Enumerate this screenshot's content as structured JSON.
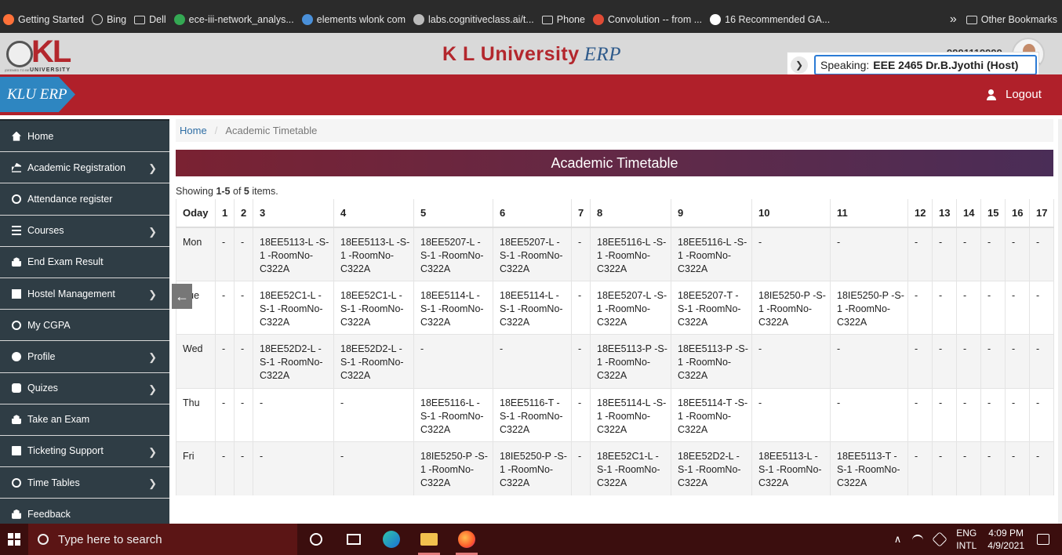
{
  "bookmarks": [
    {
      "label": "Getting Started",
      "icon": "firefox-icon",
      "color": "#ff7139"
    },
    {
      "label": "Bing",
      "icon": "globe-icon"
    },
    {
      "label": "Dell",
      "icon": "folder-icon"
    },
    {
      "label": "ece-iii-network_analys...",
      "icon": "drive-icon",
      "color": "#34a853"
    },
    {
      "label": "elements wlonk com",
      "icon": "atom-icon",
      "color": "#4a90d9"
    },
    {
      "label": "labs.cognitiveclass.ai/t...",
      "icon": "dots-icon",
      "color": "#bbbbbb"
    },
    {
      "label": "Phone",
      "icon": "folder-icon"
    },
    {
      "label": "Convolution -- from ...",
      "icon": "wolfram-icon",
      "color": "#e04b35"
    },
    {
      "label": "16 Recommended GA...",
      "icon": "medium-icon",
      "color": "#ffffff"
    }
  ],
  "other_bookmarks": "Other Bookmarks",
  "header": {
    "title": "K L University",
    "title_suffix": "ERP",
    "logo_text": "KL",
    "logo_subtext": "UNIVERSITY",
    "logo_deemed": "(DEEMED TO BE",
    "user_id": "9991119999"
  },
  "speaking": {
    "label": "Speaking:",
    "name": "EEE 2465 Dr.B.Jyothi (Host)"
  },
  "nav": {
    "brand": "KLU ERP",
    "logout": "Logout"
  },
  "sidebar": [
    {
      "label": "Home",
      "icon": "home-icon",
      "arrow": false
    },
    {
      "label": "Academic Registration",
      "icon": "bank-icon",
      "arrow": true
    },
    {
      "label": "Attendance register",
      "icon": "clock-icon",
      "arrow": false
    },
    {
      "label": "Courses",
      "icon": "list-icon",
      "arrow": true
    },
    {
      "label": "End Exam Result",
      "icon": "lock-icon",
      "arrow": false
    },
    {
      "label": "Hostel Management",
      "icon": "building-icon",
      "arrow": true
    },
    {
      "label": "My CGPA",
      "icon": "clock-icon",
      "arrow": false
    },
    {
      "label": "Profile",
      "icon": "user-icon",
      "arrow": true
    },
    {
      "label": "Quizes",
      "icon": "bus-icon",
      "arrow": true
    },
    {
      "label": "Take an Exam",
      "icon": "lock-icon",
      "arrow": false
    },
    {
      "label": "Ticketing Support",
      "icon": "document-icon",
      "arrow": true
    },
    {
      "label": "Time Tables",
      "icon": "clock-icon",
      "arrow": true
    },
    {
      "label": "Feedback",
      "icon": "lock-icon",
      "arrow": false
    }
  ],
  "breadcrumb": {
    "home": "Home",
    "current": "Academic Timetable"
  },
  "page_title": "Academic Timetable",
  "summary": {
    "prefix": "Showing",
    "range": "1-5",
    "of": "of",
    "total": "5",
    "suffix": "items."
  },
  "table": {
    "columns": [
      "Oday",
      "1",
      "2",
      "3",
      "4",
      "5",
      "6",
      "7",
      "8",
      "9",
      "10",
      "11",
      "12",
      "13",
      "14",
      "15",
      "16",
      "17"
    ],
    "rows": [
      [
        "Mon",
        "-",
        "-",
        "18EE5113-L -S-1 -RoomNo-C322A",
        "18EE5113-L -S-1 -RoomNo-C322A",
        "18EE5207-L -S-1 -RoomNo-C322A",
        "18EE5207-L -S-1 -RoomNo-C322A",
        "-",
        "18EE5116-L -S-1 -RoomNo-C322A",
        "18EE5116-L -S-1 -RoomNo-C322A",
        "-",
        "-",
        "-",
        "-",
        "-",
        "-",
        "-",
        "-"
      ],
      [
        "Tue",
        "-",
        "-",
        "18EE52C1-L -S-1 -RoomNo-C322A",
        "18EE52C1-L -S-1 -RoomNo-C322A",
        "18EE5114-L -S-1 -RoomNo-C322A",
        "18EE5114-L -S-1 -RoomNo-C322A",
        "-",
        "18EE5207-L -S-1 -RoomNo-C322A",
        "18EE5207-T -S-1 -RoomNo-C322A",
        "18IE5250-P -S-1 -RoomNo-C322A",
        "18IE5250-P -S-1 -RoomNo-C322A",
        "-",
        "-",
        "-",
        "-",
        "-",
        "-"
      ],
      [
        "Wed",
        "-",
        "-",
        "18EE52D2-L -S-1 -RoomNo-C322A",
        "18EE52D2-L -S-1 -RoomNo-C322A",
        "-",
        "-",
        "-",
        "18EE5113-P -S-1 -RoomNo-C322A",
        "18EE5113-P -S-1 -RoomNo-C322A",
        "-",
        "-",
        "-",
        "-",
        "-",
        "-",
        "-",
        "-"
      ],
      [
        "Thu",
        "-",
        "-",
        "-",
        "-",
        "18EE5116-L -S-1 -RoomNo-C322A",
        "18EE5116-T -S-1 -RoomNo-C322A",
        "-",
        "18EE5114-L -S-1 -RoomNo-C322A",
        "18EE5114-T -S-1 -RoomNo-C322A",
        "-",
        "-",
        "-",
        "-",
        "-",
        "-",
        "-",
        "-"
      ],
      [
        "Fri",
        "-",
        "-",
        "-",
        "-",
        "18IE5250-P -S-1 -RoomNo-C322A",
        "18IE5250-P -S-1 -RoomNo-C322A",
        "-",
        "18EE52C1-L -S-1 -RoomNo-C322A",
        "18EE52D2-L -S-1 -RoomNo-C322A",
        "18EE5113-L -S-1 -RoomNo-C322A",
        "18EE5113-T -S-1 -RoomNo-C322A",
        "-",
        "-",
        "-",
        "-",
        "-",
        "-"
      ]
    ]
  },
  "taskbar": {
    "search_placeholder": "Type here to search",
    "lang_1": "ENG",
    "lang_2": "INTL",
    "time": "4:09 PM",
    "date": "4/9/2021"
  },
  "colors": {
    "brand_red": "#b0202a",
    "sidebar": "#2f3d45",
    "title_gradient": "#7a2232",
    "accent_blue": "#2e86c1"
  }
}
